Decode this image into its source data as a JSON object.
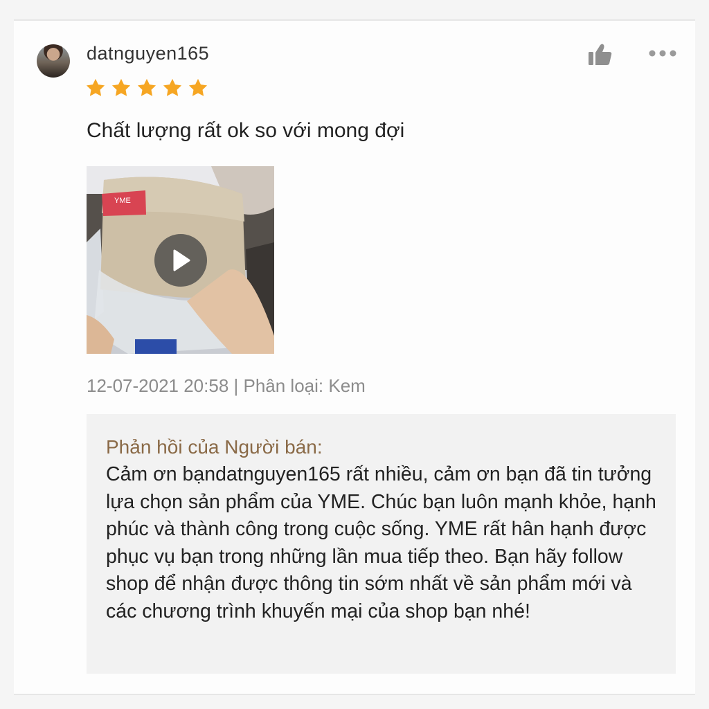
{
  "review": {
    "username": "datnguyen165",
    "rating": 5,
    "comment": "Chất lượng rất ok so với mong đợi",
    "meta": "12-07-2021 20:58 | Phân loại: Kem",
    "media": {
      "type": "video",
      "brand_tag": "YME"
    }
  },
  "seller_reply": {
    "title": "Phản hồi của Người bán:",
    "body": "Cảm ơn bạndatnguyen165 rất nhiều, cảm ơn bạn đã tin tưởng lựa chọn sản phẩm của YME. Chúc bạn luôn mạnh khỏe, hạnh phúc và thành công trong cuộc sống. YME rất hân hạnh được phục vụ bạn trong những lần mua tiếp theo. Bạn hãy follow shop để nhận được thông tin sớm nhất về sản phẩm mới và các chương trình khuyến mại của shop bạn nhé!"
  },
  "icons": {
    "star": "star-icon",
    "like": "thumbs-up-icon",
    "more": "more-dots-icon",
    "play": "play-icon"
  },
  "colors": {
    "star": "#f6a623",
    "reply_title": "#8a6a47",
    "meta": "#8c8c8c"
  }
}
